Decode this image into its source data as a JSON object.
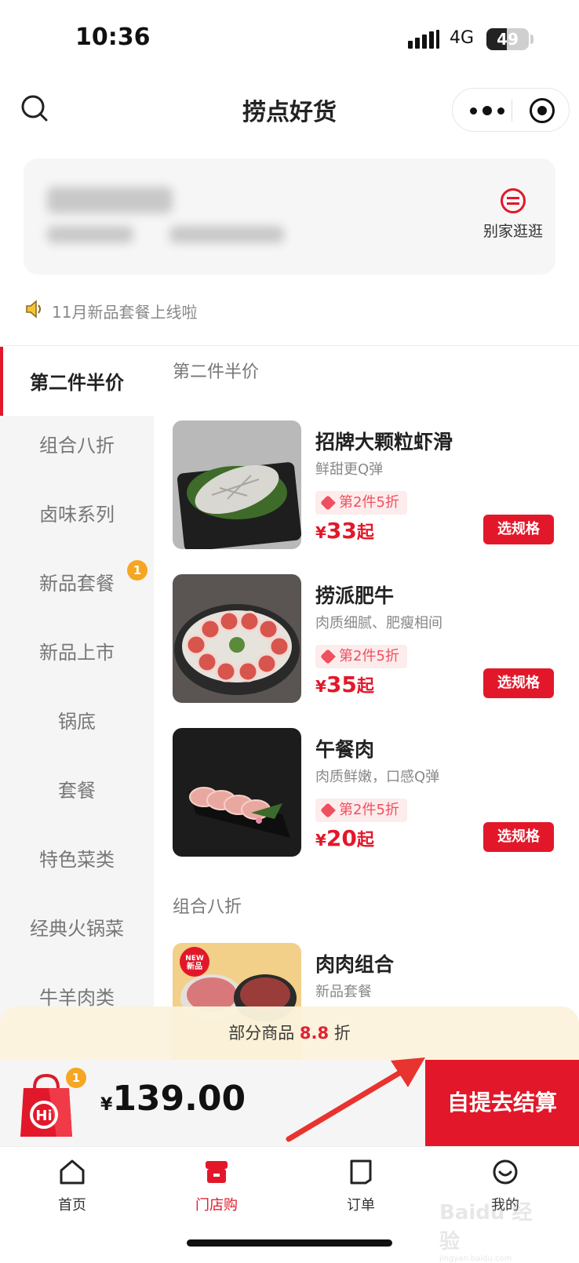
{
  "status_bar": {
    "time": "10:36",
    "network": "4G",
    "battery": "49",
    "battery_level": 0.49
  },
  "header": {
    "title": "捞点好货"
  },
  "store_card": {
    "switch_label": "别家逛逛"
  },
  "notice": {
    "text": "11月新品套餐上线啦"
  },
  "sidebar": {
    "active": "第二件半价",
    "items": [
      {
        "label": "组合八折"
      },
      {
        "label": "卤味系列"
      },
      {
        "label": "新品套餐",
        "badge": "1"
      },
      {
        "label": "新品上市"
      },
      {
        "label": "锅底"
      },
      {
        "label": "套餐"
      },
      {
        "label": "特色菜类"
      },
      {
        "label": "经典火锅菜"
      },
      {
        "label": "牛羊肉类"
      }
    ]
  },
  "sections": [
    {
      "title": "第二件半价"
    },
    {
      "title": "组合八折"
    }
  ],
  "products": [
    {
      "name": "招牌大颗粒虾滑",
      "desc": "鲜甜更Q弹",
      "tag": "第2件5折",
      "currency": "¥",
      "price": "33",
      "suffix": "起",
      "action": "选规格"
    },
    {
      "name": "捞派肥牛",
      "desc": "肉质细腻、肥瘦相间",
      "tag": "第2件5折",
      "currency": "¥",
      "price": "35",
      "suffix": "起",
      "action": "选规格"
    },
    {
      "name": "午餐肉",
      "desc": "肉质鲜嫩，口感Q弹",
      "tag": "第2件5折",
      "currency": "¥",
      "price": "20",
      "suffix": "起",
      "action": "选规格"
    },
    {
      "name": "肉肉组合",
      "desc": "新品套餐",
      "badge": "NEW\n新品"
    }
  ],
  "promo": {
    "prefix": "部分商品",
    "value": "8.8",
    "suffix": "折"
  },
  "cart": {
    "count": "1",
    "currency": "¥",
    "total": "139.00",
    "checkout": "自提去结算"
  },
  "tabbar": [
    {
      "label": "首页"
    },
    {
      "label": "门店购"
    },
    {
      "label": "订单"
    },
    {
      "label": "我的"
    }
  ],
  "colors": {
    "accent": "#e2182a",
    "badge": "#f5a623",
    "promo_bg": "#fbf3dc"
  },
  "watermark": {
    "brand": "Baidu 经验",
    "url": "jingyan.baidu.com"
  }
}
